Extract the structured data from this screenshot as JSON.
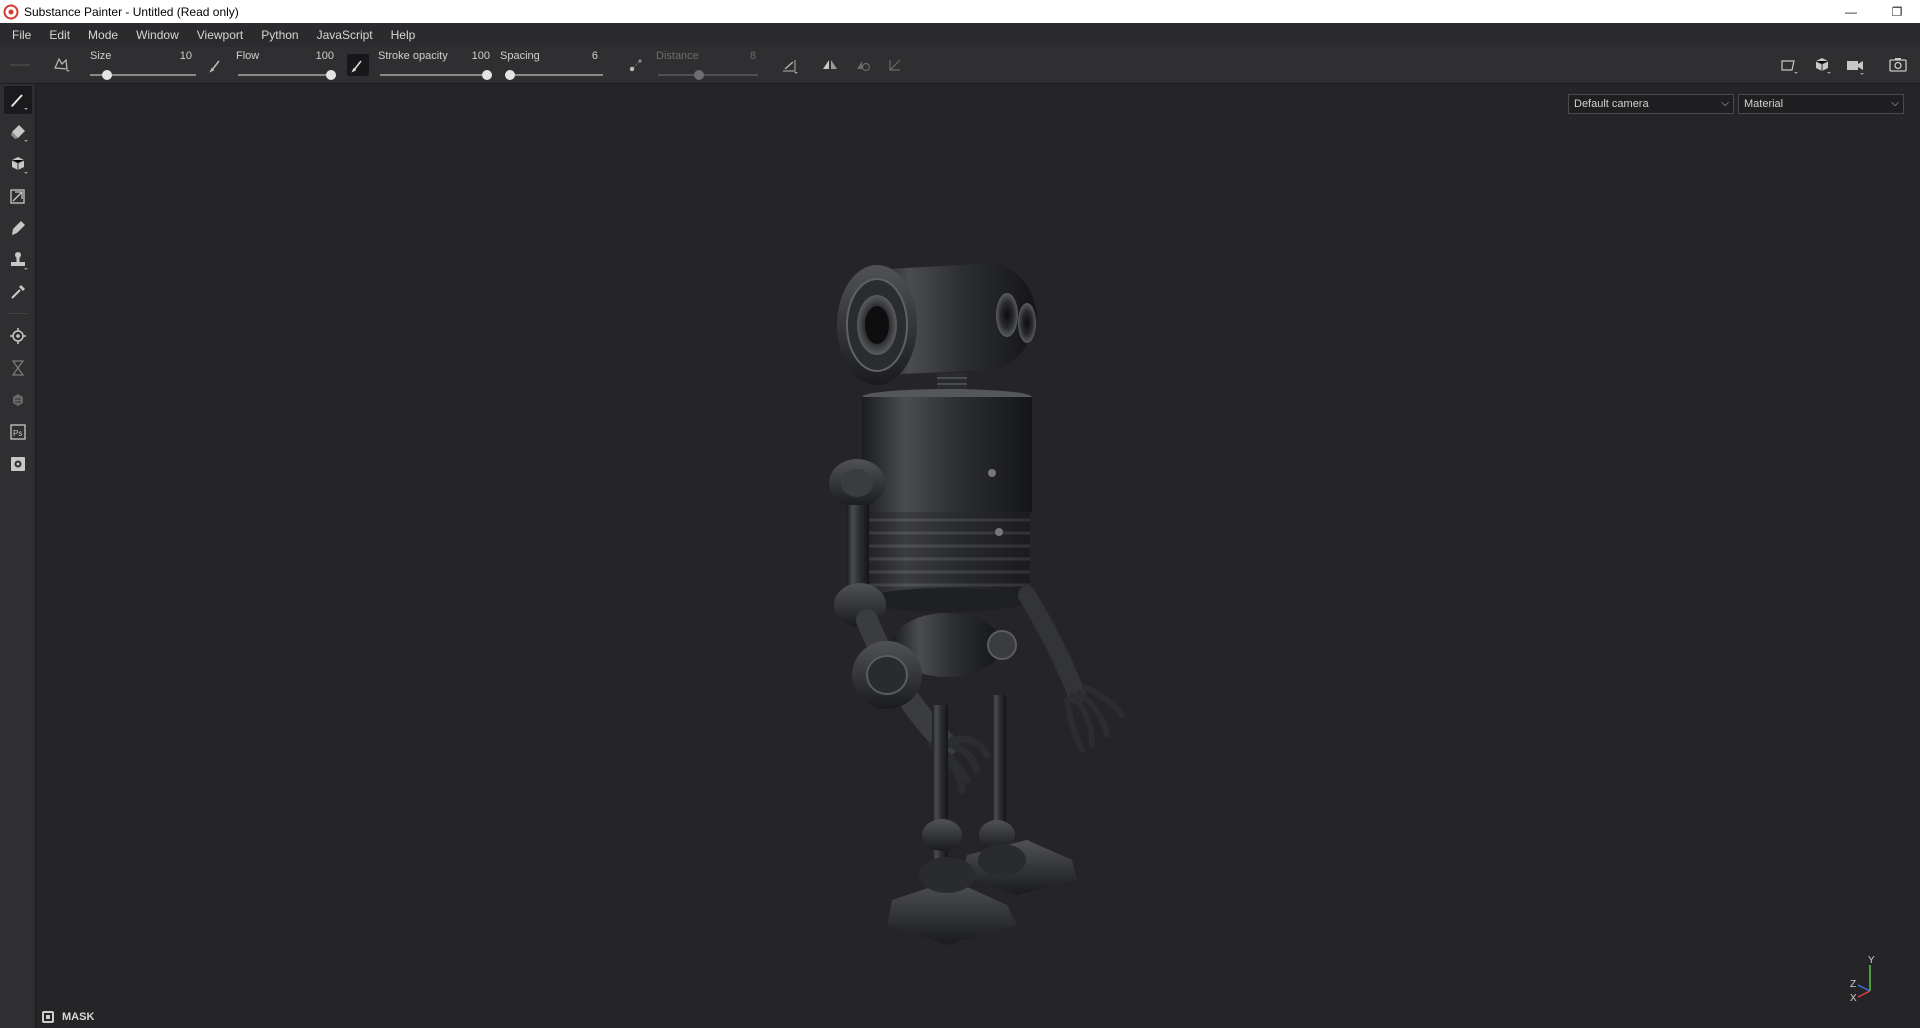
{
  "window": {
    "title": "Substance Painter - Untitled (Read only)",
    "controls": {
      "minimize": "—",
      "restore": "❐"
    }
  },
  "menu": [
    "File",
    "Edit",
    "Mode",
    "Window",
    "Viewport",
    "Python",
    "JavaScript",
    "Help"
  ],
  "tool_options": {
    "size": {
      "label": "Size",
      "value": "10",
      "fraction": 0.12
    },
    "flow": {
      "label": "Flow",
      "value": "100",
      "fraction": 1.0
    },
    "stroke_opacity": {
      "label": "Stroke opacity",
      "value": "100",
      "fraction": 1.0
    },
    "spacing": {
      "label": "Spacing",
      "value": "6",
      "fraction": 0.0
    },
    "distance": {
      "label": "Distance",
      "value": "8",
      "fraction": 0.4
    }
  },
  "left_tools": [
    "paint-brush-icon",
    "eraser-icon",
    "projection-icon",
    "polygon-fill-icon",
    "smudge-icon",
    "clone-stamp-icon",
    "color-picker-icon",
    "bake-settings-icon",
    "history-icon",
    "effects-icon",
    "photoshop-icon",
    "export-icon"
  ],
  "viewport": {
    "camera": "Default camera",
    "mode": "Material",
    "axis_y": "Y",
    "axis_z": "Z",
    "axis_x": "X"
  },
  "mask": {
    "label": "MASK"
  },
  "colors": {
    "background": "#252528",
    "panel": "#2f2f31",
    "menubar": "#2b2b2d",
    "axis_y": "#58c840",
    "axis_x": "#e04040",
    "axis_z": "#4070e0"
  }
}
